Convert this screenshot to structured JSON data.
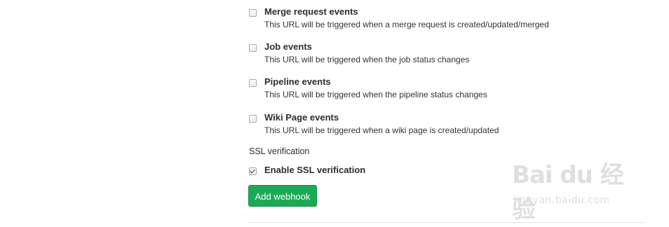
{
  "events": [
    {
      "title": "Merge request events",
      "desc": "This URL will be triggered when a merge request is created/updated/merged",
      "checked": false
    },
    {
      "title": "Job events",
      "desc": "This URL will be triggered when the job status changes",
      "checked": false
    },
    {
      "title": "Pipeline events",
      "desc": "This URL will be triggered when the pipeline status changes",
      "checked": false
    },
    {
      "title": "Wiki Page events",
      "desc": "This URL will be triggered when a wiki page is created/updated",
      "checked": false
    }
  ],
  "ssl": {
    "section_label": "SSL verification",
    "option_label": "Enable SSL verification",
    "checked": true
  },
  "actions": {
    "add_webhook_label": "Add webhook"
  },
  "watermark": {
    "logo_text": "Bai du 经验",
    "url_text": "jingyan.baidu.com"
  },
  "colors": {
    "primary_button": "#1aaa55"
  }
}
